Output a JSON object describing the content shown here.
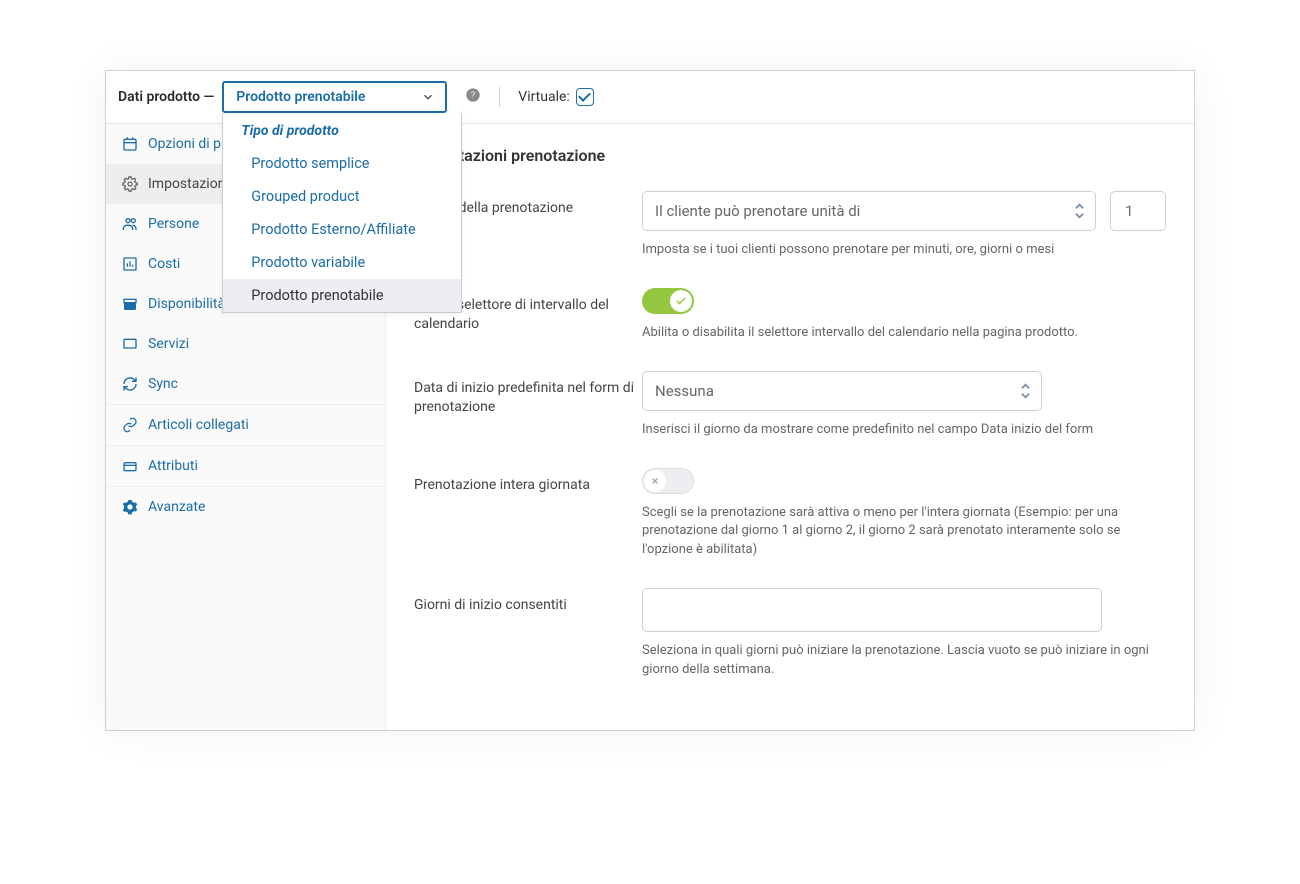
{
  "header": {
    "label": "Dati prodotto —",
    "product_type_selected": "Prodotto prenotabile",
    "dropdown_header": "Tipo di prodotto",
    "dropdown_items": [
      "Prodotto semplice",
      "Grouped product",
      "Prodotto Esterno/Affiliate",
      "Prodotto variabile",
      "Prodotto prenotabile"
    ],
    "virtual_label": "Virtuale:",
    "virtual_checked": true
  },
  "sidebar": {
    "items": [
      {
        "icon": "calendar",
        "label": "Opzioni di prenotazione"
      },
      {
        "icon": "gear",
        "label": "Impostazioni prenotazione"
      },
      {
        "icon": "people",
        "label": "Persone"
      },
      {
        "icon": "chart",
        "label": "Costi"
      },
      {
        "icon": "date",
        "label": "Disponibilità"
      },
      {
        "icon": "screen",
        "label": "Servizi"
      },
      {
        "icon": "sync",
        "label": "Sync"
      },
      {
        "icon": "link",
        "label": "Articoli collegati"
      },
      {
        "icon": "badge",
        "label": "Attributi"
      },
      {
        "icon": "cog",
        "label": "Avanzate"
      }
    ]
  },
  "main": {
    "section_title": "Impostazioni prenotazione",
    "duration": {
      "label": "Durata della prenotazione",
      "select_value": "Il cliente può prenotare unità di",
      "num_value": "1",
      "desc": "Imposta se i tuoi clienti possono prenotare per minuti, ore, giorni o mesi"
    },
    "range": {
      "label": "Abilita selettore di intervallo del calendario",
      "on": true,
      "desc": "Abilita o disabilita il selettore intervallo del calendario nella pagina prodotto."
    },
    "default_date": {
      "label": "Data di inizio predefinita nel form di prenotazione",
      "select_value": "Nessuna",
      "desc": "Inserisci il giorno da mostrare come predefinito nel campo Data inizio del form"
    },
    "full_day": {
      "label": "Prenotazione intera giornata",
      "on": false,
      "desc": "Scegli se la prenotazione sarà attiva o meno per l'intera giornata (Esempio: per una prenotazione dal giorno 1 al giorno 2, il giorno 2 sarà prenotato interamente solo se l'opzione è abilitata)"
    },
    "allowed_days": {
      "label": "Giorni di inizio consentiti",
      "value": "",
      "desc": "Seleziona in quali giorni può iniziare la prenotazione. Lascia vuoto se può iniziare in ogni giorno della settimana."
    }
  }
}
